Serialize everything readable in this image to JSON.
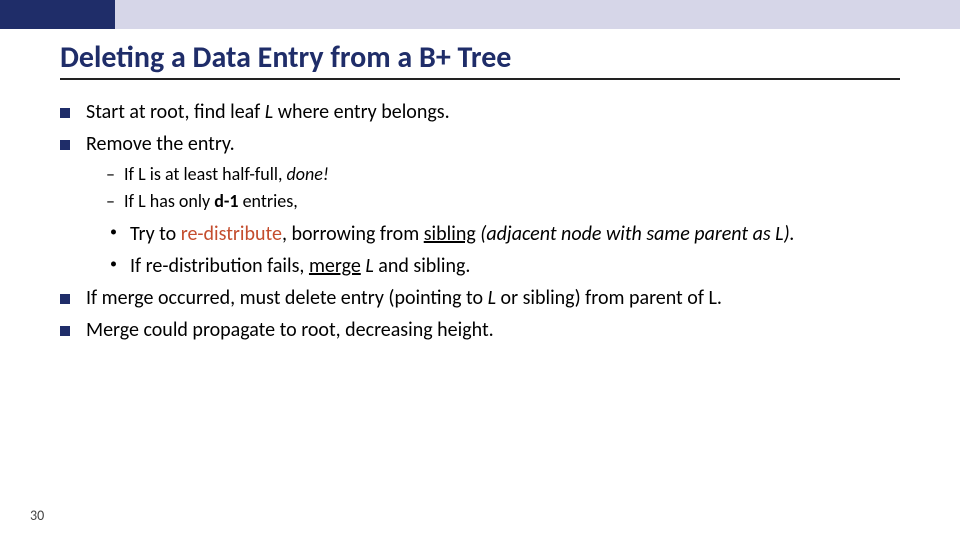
{
  "slide": {
    "number": "30",
    "title": "Deleting a Data Entry from a B+ Tree",
    "b1": {
      "pre": "Start at root, find leaf ",
      "L": "L",
      "post": " where entry belongs."
    },
    "b2": {
      "text": "Remove the entry."
    },
    "s1": {
      "pre": "If L is at least half-full, ",
      "done": "done!"
    },
    "s2": {
      "pre": "If L has only ",
      "d1": "d-1",
      "post": " entries,"
    },
    "t1": {
      "pre": "Try to ",
      "redist": "re-distribute",
      "mid": ", borrowing from ",
      "sibling": "sibling",
      "post1": " (adjacent node with same parent as ",
      "Lword": "L).",
      "post2": ""
    },
    "t2": {
      "pre": "If re-distribution fails, ",
      "merge": "merge",
      "mid": " ",
      "L": "L",
      "post": " and sibling."
    },
    "b3": {
      "pre": "If merge occurred, must delete entry (pointing to ",
      "L": "L",
      "post": " or sibling) from parent of L."
    },
    "b4": {
      "text": "Merge could propagate to root, decreasing height."
    }
  }
}
